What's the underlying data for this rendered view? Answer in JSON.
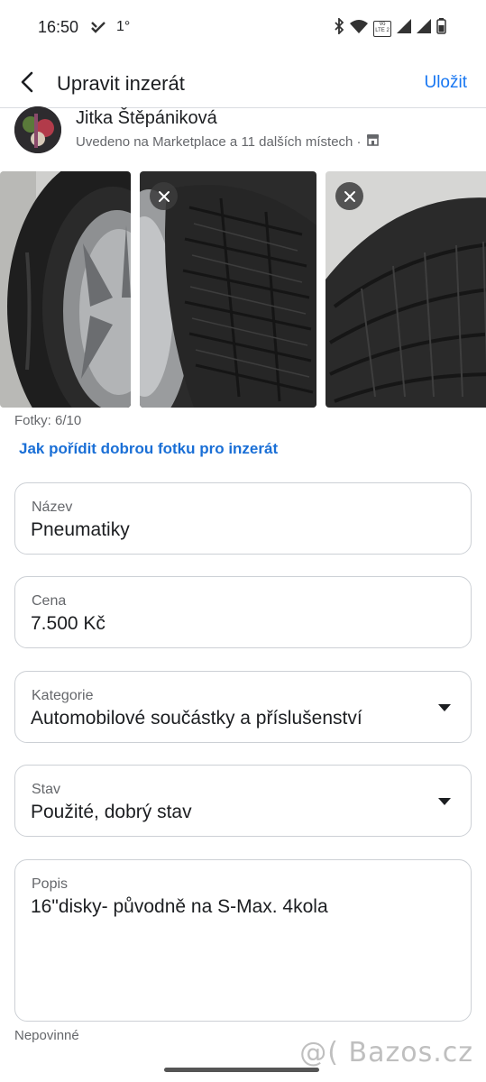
{
  "status_bar": {
    "time": "16:50",
    "temperature": "1°",
    "icons": [
      "signal-app-icon",
      "bluetooth-icon",
      "wifi-icon",
      "volte-icon",
      "cell-signal-icon",
      "cell-signal-icon",
      "battery-icon"
    ],
    "volte_text": "Vo LTE 2"
  },
  "header": {
    "title": "Upravit inzerát",
    "save_label": "Uložit"
  },
  "seller": {
    "name": "Jitka Štěpániková",
    "listed_text": "Uvedeno na Marketplace a 11 dalších místech ·"
  },
  "photos": {
    "count_text": "Fotky: 6/10",
    "help_link": "Jak pořídit dobrou fotku pro inzerát"
  },
  "fields": {
    "title": {
      "label": "Název",
      "value": "Pneumatiky"
    },
    "price": {
      "label": "Cena",
      "value": "7.500 Kč"
    },
    "category": {
      "label": "Kategorie",
      "value": "Automobilové součástky a příslušenství"
    },
    "condition": {
      "label": "Stav",
      "value": "Použité, dobrý stav"
    },
    "description": {
      "label": "Popis",
      "value": "16\"disky- původně na S-Max. 4kola"
    }
  },
  "optional_text": "Nepovinné",
  "watermark": "@( Bazos.cz"
}
